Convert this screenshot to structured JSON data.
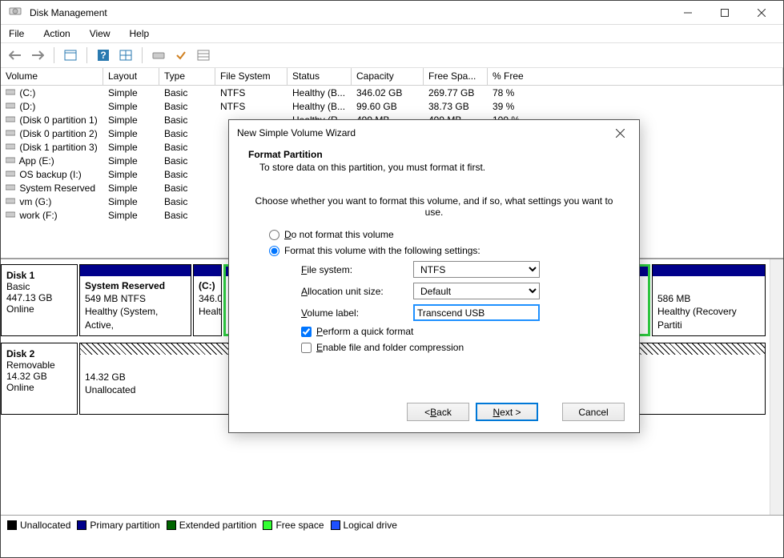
{
  "window": {
    "title": "Disk Management"
  },
  "menus": {
    "file": "File",
    "action": "Action",
    "view": "View",
    "help": "Help"
  },
  "columns": {
    "volume": "Volume",
    "layout": "Layout",
    "type": "Type",
    "fs": "File System",
    "status": "Status",
    "capacity": "Capacity",
    "free": "Free Spa...",
    "pct": "% Free"
  },
  "volumes": [
    {
      "name": "(C:)",
      "layout": "Simple",
      "type": "Basic",
      "fs": "NTFS",
      "status": "Healthy (B...",
      "capacity": "346.02 GB",
      "free": "269.77 GB",
      "pct": "78 %"
    },
    {
      "name": "(D:)",
      "layout": "Simple",
      "type": "Basic",
      "fs": "NTFS",
      "status": "Healthy (B...",
      "capacity": "99.60 GB",
      "free": "38.73 GB",
      "pct": "39 %"
    },
    {
      "name": "(Disk 0 partition 1)",
      "layout": "Simple",
      "type": "Basic",
      "fs": "",
      "status": "Healthy (R...",
      "capacity": "499 MB",
      "free": "499 MB",
      "pct": "100 %"
    },
    {
      "name": "(Disk 0 partition 2)",
      "layout": "Simple",
      "type": "Basic",
      "fs": "",
      "status": "",
      "capacity": "",
      "free": "",
      "pct": ""
    },
    {
      "name": "(Disk 1 partition 3)",
      "layout": "Simple",
      "type": "Basic",
      "fs": "",
      "status": "",
      "capacity": "",
      "free": "",
      "pct": ""
    },
    {
      "name": "App (E:)",
      "layout": "Simple",
      "type": "Basic",
      "fs": "",
      "status": "",
      "capacity": "",
      "free": "",
      "pct": ""
    },
    {
      "name": "OS backup (I:)",
      "layout": "Simple",
      "type": "Basic",
      "fs": "",
      "status": "",
      "capacity": "",
      "free": "",
      "pct": ""
    },
    {
      "name": "System Reserved",
      "layout": "Simple",
      "type": "Basic",
      "fs": "",
      "status": "",
      "capacity": "",
      "free": "",
      "pct": ""
    },
    {
      "name": "vm (G:)",
      "layout": "Simple",
      "type": "Basic",
      "fs": "",
      "status": "",
      "capacity": "",
      "free": "",
      "pct": ""
    },
    {
      "name": "work (F:)",
      "layout": "Simple",
      "type": "Basic",
      "fs": "",
      "status": "",
      "capacity": "",
      "free": "",
      "pct": ""
    }
  ],
  "disks": {
    "d1": {
      "name": "Disk 1",
      "type": "Basic",
      "size": "447.13 GB",
      "state": "Online"
    },
    "d2": {
      "name": "Disk 2",
      "type": "Removable",
      "size": "14.32 GB",
      "state": "Online"
    }
  },
  "parts": {
    "sysres": {
      "title": "System Reserved",
      "l2": "549 MB NTFS",
      "l3": "Healthy (System, Active,"
    },
    "c": {
      "title": "(C:)",
      "l2": "346.0",
      "l3": "Healt"
    },
    "rec": {
      "l2": "586 MB",
      "l3": "Healthy (Recovery Partiti"
    },
    "unalloc2": {
      "l2": "14.32 GB",
      "l3": "Unallocated"
    }
  },
  "legend": {
    "unalloc": "Unallocated",
    "primary": "Primary partition",
    "ext": "Extended partition",
    "free": "Free space",
    "logical": "Logical drive"
  },
  "wizard": {
    "title": "New Simple Volume Wizard",
    "header": "Format Partition",
    "sub": "To store data on this partition, you must format it first.",
    "intro": "Choose whether you want to format this volume, and if so, what settings you want to use.",
    "opt_noformat": "Do not format this volume",
    "opt_format": "Format this volume with the following settings:",
    "lbl_fs": "File system:",
    "lbl_au": "Allocation unit size:",
    "lbl_vl": "Volume label:",
    "val_fs": "NTFS",
    "val_au": "Default",
    "val_vl": "Transcend USB",
    "chk_quick": "Perform a quick format",
    "chk_compress": "Enable file and folder compression",
    "btn_back": "< Back",
    "btn_next": "Next >",
    "btn_cancel": "Cancel"
  }
}
